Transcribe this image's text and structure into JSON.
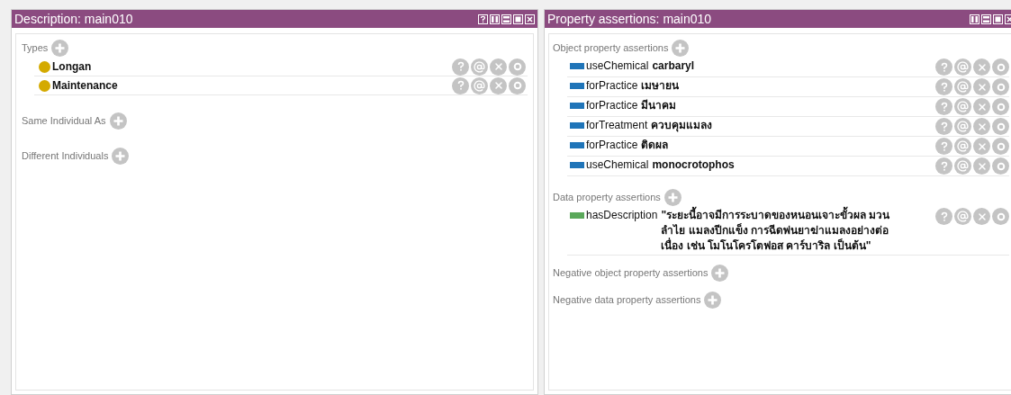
{
  "description_panel": {
    "title": "Description: main010",
    "sections": [
      {
        "label": "Types",
        "items": [
          {
            "label": "Longan",
            "color": "#d4aa00"
          },
          {
            "label": "Maintenance",
            "color": "#d4aa00"
          }
        ]
      },
      {
        "label": "Same Individual As"
      },
      {
        "label": "Different Individuals"
      }
    ]
  },
  "property_panel": {
    "title": "Property assertions: main010",
    "sections": [
      {
        "label": "Object property assertions",
        "items": [
          {
            "property": "useChemical",
            "value": "carbaryl",
            "color": "#1f74b8"
          },
          {
            "property": "forPractice",
            "value": "เมษายน",
            "color": "#1f74b8"
          },
          {
            "property": "forPractice",
            "value": "มีนาคม",
            "color": "#1f74b8"
          },
          {
            "property": "forTreatment",
            "value": "ควบคุมแมลง",
            "color": "#1f74b8"
          },
          {
            "property": "forPractice",
            "value": "ติดผล",
            "color": "#1f74b8"
          },
          {
            "property": "useChemical",
            "value": "monocrotophos",
            "color": "#1f74b8"
          }
        ]
      },
      {
        "label": "Data property assertions",
        "items": [
          {
            "property": "hasDescription",
            "value": "\"ระยะนี้อาจมีการระบาดของหนอนเจาะขั้วผล มวนลำไย แมลงปีกแข็ง การฉีดพ่นยาฆ่าแมลงอย่างต่อเนื่อง เช่น โมโนโครโตฟอส คาร์บาริล เป็นต้น\"",
            "color": "#5aa85a"
          }
        ]
      },
      {
        "label": "Negative object property assertions"
      },
      {
        "label": "Negative data property assertions"
      }
    ]
  }
}
